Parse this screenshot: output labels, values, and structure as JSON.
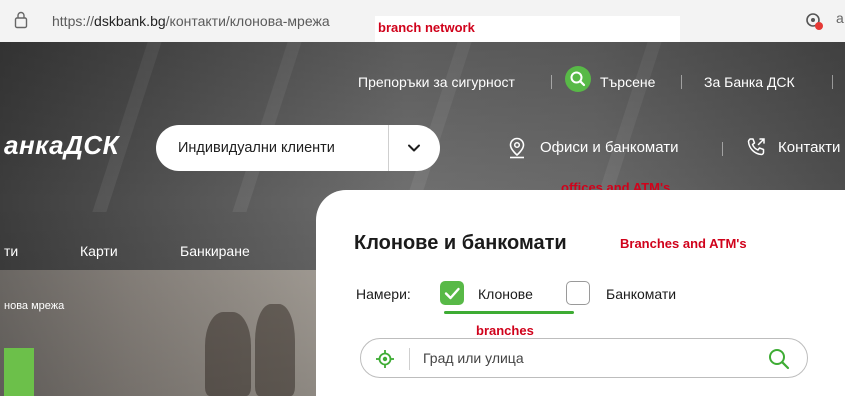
{
  "browser": {
    "url_prefix": "https://",
    "url_host": "dskbank.bg",
    "url_path": "/контакти/клонова-мрежа",
    "more_glyph": "a"
  },
  "annotations": {
    "url": "branch network",
    "offices": "offices and ATM's",
    "title": "Branches and ATM's",
    "branches": "branches"
  },
  "header": {
    "top_links": {
      "security": "Препоръки за сигурност",
      "search": "Търсене",
      "about": "За Банка ДСК"
    },
    "logo": "анкаДСК",
    "segment_label": "Индивидуални клиенти",
    "offices_label": "Офиси и банкомати",
    "contacts_label": "Контакти"
  },
  "nav": {
    "items": [
      "ти",
      "Карти",
      "Банкиране"
    ]
  },
  "breadcrumb": "нова мрежа",
  "panel": {
    "title": "Клонове и банкомати",
    "find_label": "Намери:",
    "options": [
      {
        "label": "Клонове",
        "checked": true
      },
      {
        "label": "Банкомати",
        "checked": false
      }
    ],
    "search_placeholder": "Град или улица"
  },
  "colors": {
    "brand_green": "#58b947",
    "annotation_red": "#d0021b"
  },
  "icons": {
    "lock": "lock-icon",
    "extension": "location-badge-icon",
    "search": "search-icon",
    "location": "location-pin-icon",
    "phone": "phone-icon",
    "chevron": "chevron-down-icon",
    "check": "check-icon",
    "locate": "locate-crosshair-icon"
  }
}
